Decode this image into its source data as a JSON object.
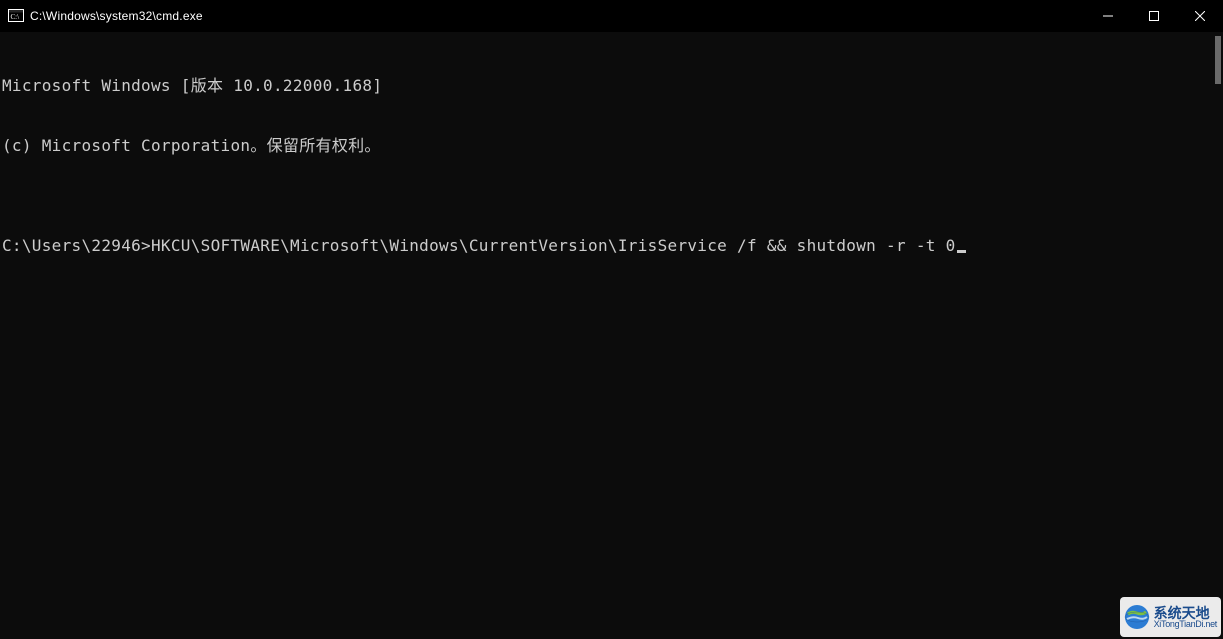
{
  "window": {
    "title": "C:\\Windows\\system32\\cmd.exe"
  },
  "terminal": {
    "line1": "Microsoft Windows [版本 10.0.22000.168]",
    "line2": "(c) Microsoft Corporation。保留所有权利。",
    "blank": "",
    "prompt": "C:\\Users\\22946>",
    "command": "HKCU\\SOFTWARE\\Microsoft\\Windows\\CurrentVersion\\IrisService /f && shutdown -r -t 0"
  },
  "watermark": {
    "line1": "系统天地",
    "line2": "XiTongTianDi.net"
  }
}
